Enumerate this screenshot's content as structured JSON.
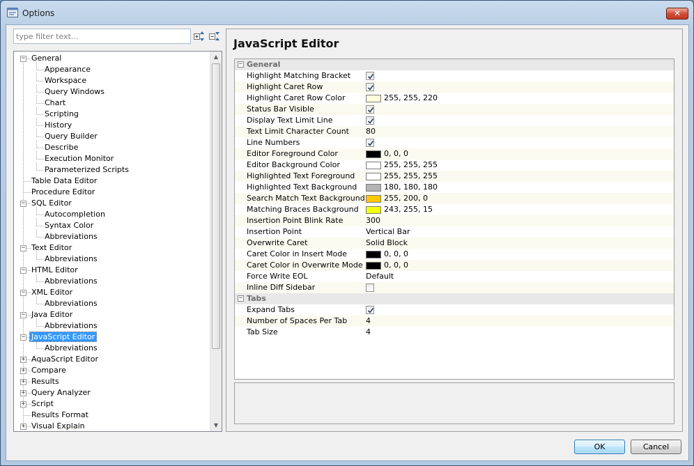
{
  "window": {
    "title": "Options"
  },
  "filter": {
    "placeholder": "type filter text..."
  },
  "tree": [
    {
      "label": "General",
      "level": 0,
      "toggle": "minus"
    },
    {
      "label": "Appearance",
      "level": 1
    },
    {
      "label": "Workspace",
      "level": 1
    },
    {
      "label": "Query Windows",
      "level": 1
    },
    {
      "label": "Chart",
      "level": 1
    },
    {
      "label": "Scripting",
      "level": 1
    },
    {
      "label": "History",
      "level": 1
    },
    {
      "label": "Query Builder",
      "level": 1
    },
    {
      "label": "Describe",
      "level": 1
    },
    {
      "label": "Execution Monitor",
      "level": 1
    },
    {
      "label": "Parameterized Scripts",
      "level": 1
    },
    {
      "label": "Table Data Editor",
      "level": 0
    },
    {
      "label": "Procedure Editor",
      "level": 0
    },
    {
      "label": "SQL Editor",
      "level": 0,
      "toggle": "minus"
    },
    {
      "label": "Autocompletion",
      "level": 1
    },
    {
      "label": "Syntax Color",
      "level": 1
    },
    {
      "label": "Abbreviations",
      "level": 1
    },
    {
      "label": "Text Editor",
      "level": 0,
      "toggle": "minus"
    },
    {
      "label": "Abbreviations",
      "level": 1
    },
    {
      "label": "HTML Editor",
      "level": 0,
      "toggle": "minus"
    },
    {
      "label": "Abbreviations",
      "level": 1
    },
    {
      "label": "XML Editor",
      "level": 0,
      "toggle": "minus"
    },
    {
      "label": "Abbreviations",
      "level": 1
    },
    {
      "label": "Java Editor",
      "level": 0,
      "toggle": "minus"
    },
    {
      "label": "Abbreviations",
      "level": 1
    },
    {
      "label": "JavaScript Editor",
      "level": 0,
      "toggle": "minus",
      "selected": true
    },
    {
      "label": "Abbreviations",
      "level": 1
    },
    {
      "label": "AquaScript Editor",
      "level": 0,
      "toggle": "plus"
    },
    {
      "label": "Compare",
      "level": 0,
      "toggle": "plus"
    },
    {
      "label": "Results",
      "level": 0,
      "toggle": "plus"
    },
    {
      "label": "Query Analyzer",
      "level": 0,
      "toggle": "plus"
    },
    {
      "label": "Script",
      "level": 0,
      "toggle": "plus"
    },
    {
      "label": "Results Format",
      "level": 0
    },
    {
      "label": "Visual Explain",
      "level": 0,
      "toggle": "plus"
    }
  ],
  "page": {
    "title": "JavaScript Editor"
  },
  "properties": [
    {
      "kind": "category",
      "label": "General"
    },
    {
      "name": "Highlight Matching Bracket",
      "type": "checkbox",
      "checked": true
    },
    {
      "name": "Highlight Caret Row",
      "type": "checkbox",
      "checked": true
    },
    {
      "name": "Highlight Caret Row Color",
      "type": "color",
      "color": "#fffddc",
      "value": "255, 255, 220"
    },
    {
      "name": "Status Bar Visible",
      "type": "checkbox",
      "checked": true
    },
    {
      "name": "Display Text Limit Line",
      "type": "checkbox",
      "checked": true
    },
    {
      "name": "Text Limit Character Count",
      "type": "text",
      "value": "80"
    },
    {
      "name": "Line Numbers",
      "type": "checkbox",
      "checked": true
    },
    {
      "name": "Editor Foreground Color",
      "type": "color",
      "color": "#000000",
      "value": "0, 0, 0"
    },
    {
      "name": "Editor Background Color",
      "type": "color",
      "color": "#ffffff",
      "value": "255, 255, 255"
    },
    {
      "name": "Highlighted Text Foreground",
      "type": "color",
      "color": "#ffffff",
      "value": "255, 255, 255"
    },
    {
      "name": "Highlighted Text Background",
      "type": "color",
      "color": "#b4b4b4",
      "value": "180, 180, 180"
    },
    {
      "name": "Search Match Text Background",
      "type": "color",
      "color": "#ffc800",
      "value": "255, 200, 0"
    },
    {
      "name": "Matching Braces Background",
      "type": "color",
      "color": "#f3ff0f",
      "value": "243, 255, 15"
    },
    {
      "name": "Insertion Point Blink Rate",
      "type": "text",
      "value": "300"
    },
    {
      "name": "Insertion Point",
      "type": "text",
      "value": "Vertical Bar"
    },
    {
      "name": "Overwrite Caret",
      "type": "text",
      "value": "Solid Block"
    },
    {
      "name": "Caret Color in Insert Mode",
      "type": "color",
      "color": "#000000",
      "value": "0, 0, 0"
    },
    {
      "name": "Caret Color in Overwrite Mode",
      "type": "color",
      "color": "#000000",
      "value": "0, 0, 0"
    },
    {
      "name": "Force Write EOL",
      "type": "text",
      "value": "Default"
    },
    {
      "name": "Inline Diff Sidebar",
      "type": "checkbox",
      "checked": false
    },
    {
      "kind": "category",
      "label": "Tabs"
    },
    {
      "name": "Expand Tabs",
      "type": "checkbox",
      "checked": true
    },
    {
      "name": "Number of Spaces Per Tab",
      "type": "text",
      "value": "4"
    },
    {
      "name": "Tab Size",
      "type": "text",
      "value": "4"
    }
  ],
  "buttons": {
    "ok": "OK",
    "cancel": "Cancel"
  },
  "icons": {
    "close": "close-icon",
    "expand_all": "expand-all-icon",
    "collapse_all": "collapse-all-icon",
    "window": "options-window-icon"
  }
}
